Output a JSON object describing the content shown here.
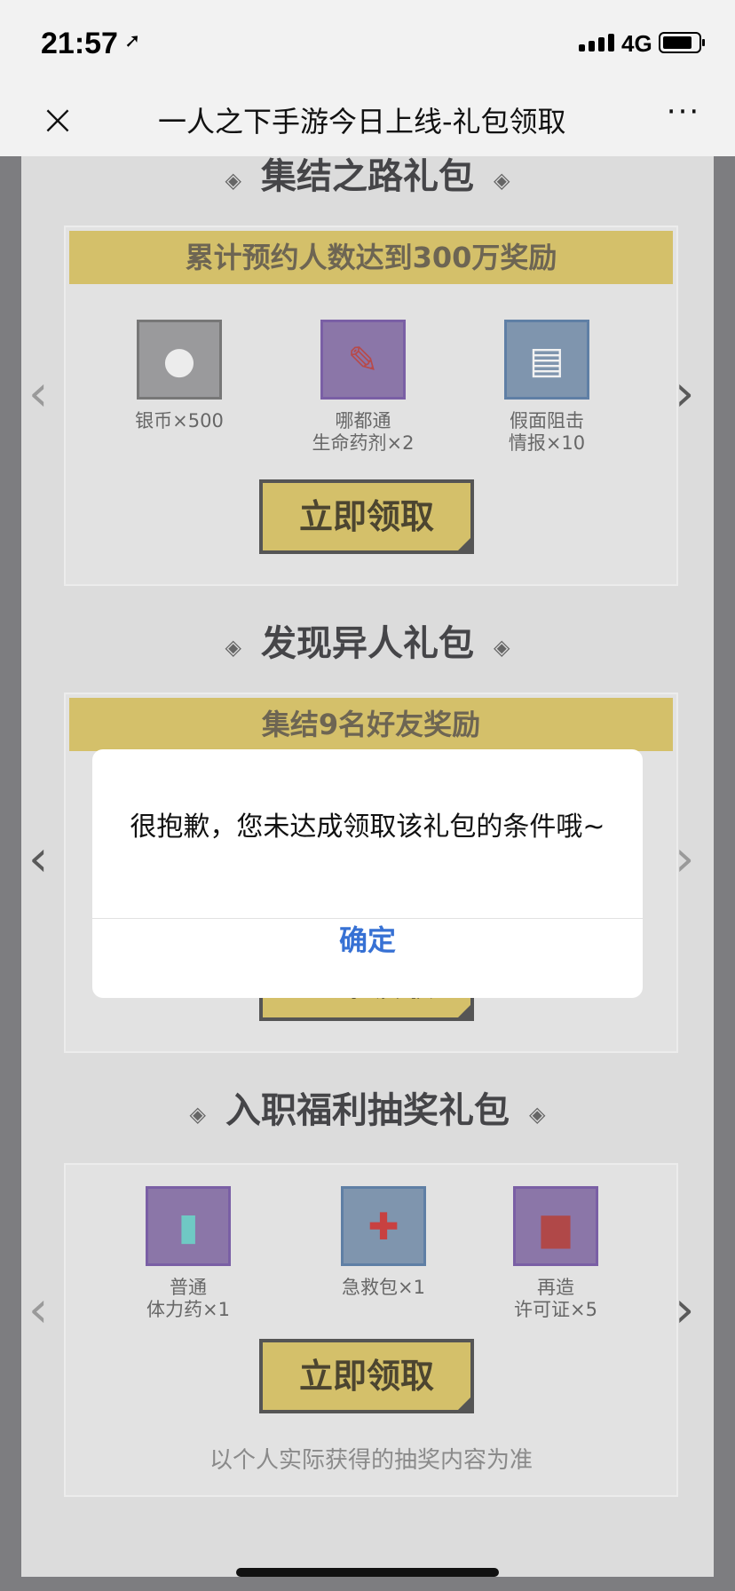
{
  "status_bar": {
    "time": "21:57",
    "network": "4G"
  },
  "nav": {
    "title": "一人之下手游今日上线-礼包领取",
    "close_glyph": "×",
    "more_glyph": "···"
  },
  "sections": [
    {
      "title": "集结之路礼包",
      "banner": "累计预约人数达到300万奖励",
      "items": [
        {
          "label": "银币×500",
          "icon": "silver-coin-icon"
        },
        {
          "label": "哪都通\n生命药剂×2",
          "icon": "potion-vial-icon"
        },
        {
          "label": "假面阻击\n情报×10",
          "icon": "intel-document-icon"
        }
      ],
      "claim_label": "立即领取"
    },
    {
      "title": "发现异人礼包",
      "banner": "集结9名好友奖励",
      "claim_label": "立即领取"
    },
    {
      "title": "入职福利抽奖礼包",
      "items": [
        {
          "label": "普通\n体力药×1",
          "icon": "stamina-bottle-icon"
        },
        {
          "label": "急救包×1",
          "icon": "first-aid-kit-icon"
        },
        {
          "label": "再造\n许可证×5",
          "icon": "permit-book-icon"
        }
      ],
      "claim_label": "立即领取",
      "footnote": "以个人实际获得的抽奖内容为准"
    }
  ],
  "dialog": {
    "message": "很抱歉，您未达成领取该礼包的条件哦~",
    "confirm_label": "确定"
  },
  "colors": {
    "accent_blue": "#3771d4",
    "gold": "#d4c06a"
  }
}
